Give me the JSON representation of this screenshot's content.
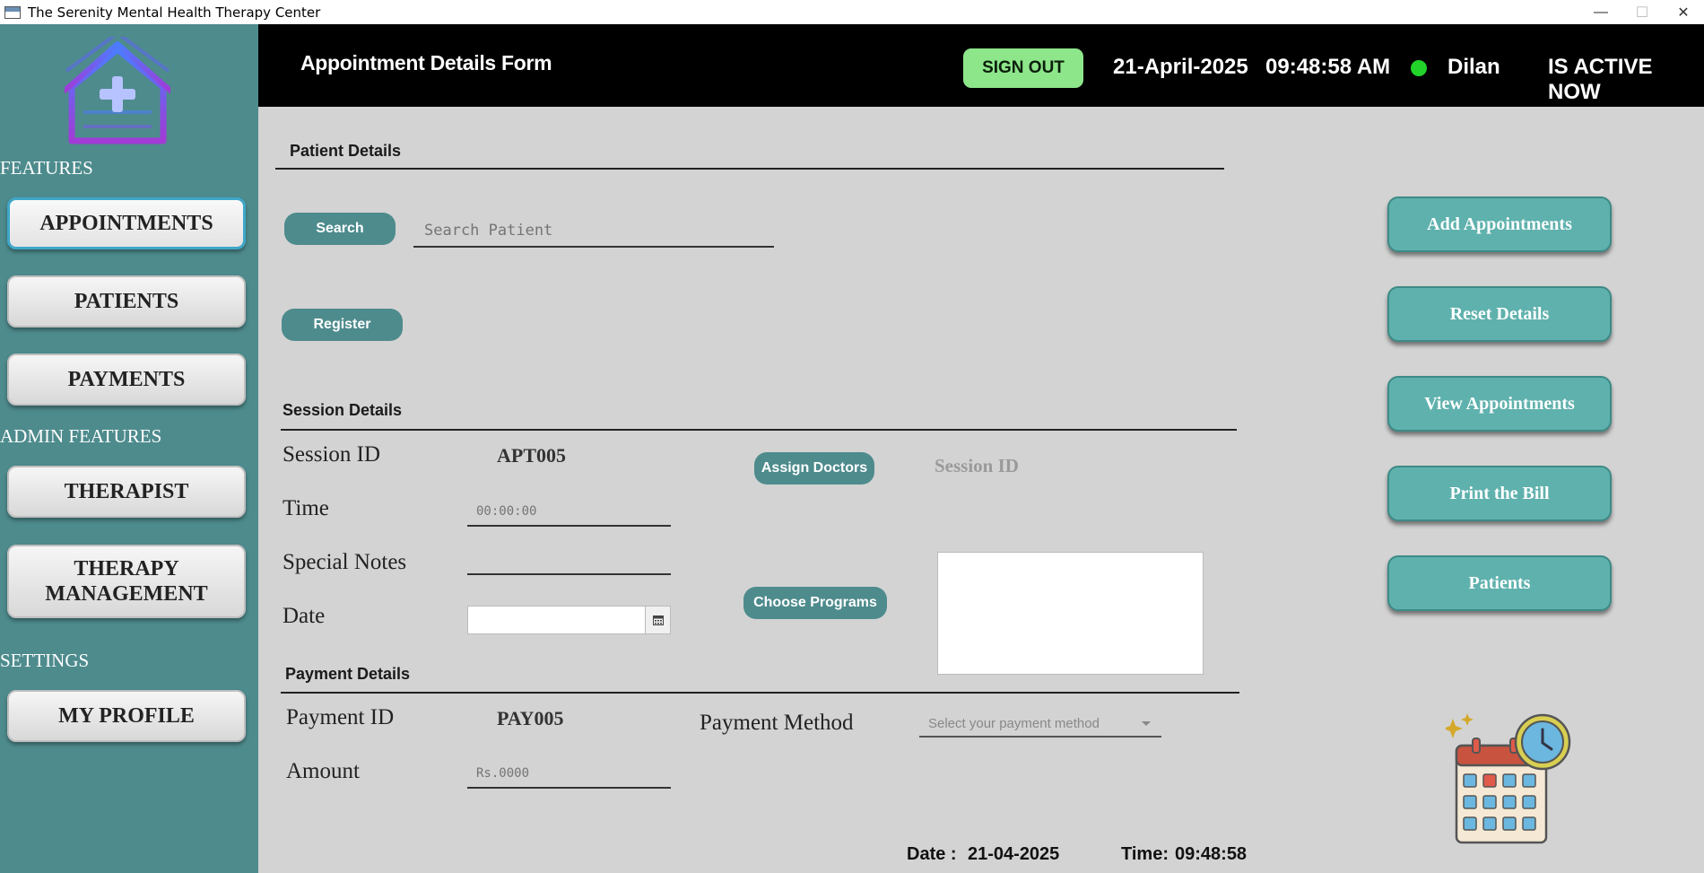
{
  "window": {
    "title": "The Serenity Mental Health Therapy Center",
    "minimize": "—",
    "maximize": "☐",
    "close": "✕"
  },
  "sidebar": {
    "logo_icon": "house-plus-icon",
    "sections": {
      "features": "FEATURES",
      "admin_features": "ADMIN FEATURES",
      "settings": "SETTINGS"
    },
    "items": {
      "appointments": "APPOINTMENTS",
      "patients": "PATIENTS",
      "payments": "PAYMENTS",
      "therapist": "THERAPIST",
      "therapy_management": "THERAPY\nMANAGEMENT",
      "my_profile": "MY PROFILE"
    },
    "active_item": "APPOINTMENTS",
    "colors": {
      "background": "#4e8b8d",
      "active_border": "#3fa7c9"
    }
  },
  "header": {
    "form_title": "Appointment Details Form",
    "sign_out": "SIGN OUT",
    "date": "21-April-2025",
    "time": "09:48:58  AM",
    "user": "Dilan",
    "status": "IS ACTIVE NOW",
    "colors": {
      "background": "#000000",
      "sign_out": "#8ee68a",
      "status_dot": "#22d32a"
    }
  },
  "patient_details": {
    "title": "Patient Details",
    "search_button": "Search",
    "search_placeholder": "Search Patient",
    "register_button": "Register"
  },
  "session_details": {
    "title": "Session Details",
    "session_id_label": "Session ID",
    "session_id_value": "APT005",
    "time_label": "Time",
    "time_placeholder": "00:00:00",
    "special_notes_label": "Special Notes",
    "date_label": "Date",
    "assign_doctors_button": "Assign Doctors",
    "assigned_session_id": "Session ID",
    "choose_programs_button": "Choose  Programs"
  },
  "payment_details": {
    "title": "Payment Details",
    "payment_id_label": "Payment ID",
    "payment_id_value": "PAY005",
    "payment_method_label": "Payment Method",
    "payment_method_placeholder": "Select your payment method",
    "amount_label": "Amount",
    "amount_placeholder": "Rs.0000"
  },
  "footer": {
    "date_label": "Date :",
    "date_value": "21-04-2025",
    "time_label": "Time:",
    "time_value": "09:48:58"
  },
  "actions": {
    "add": "Add Appointments",
    "reset": "Reset Details",
    "view": "View Appointments",
    "print": "Print the Bill",
    "patients": "Patients",
    "color": "#5fb1ad"
  },
  "illustration": "calendar-clock-icon"
}
